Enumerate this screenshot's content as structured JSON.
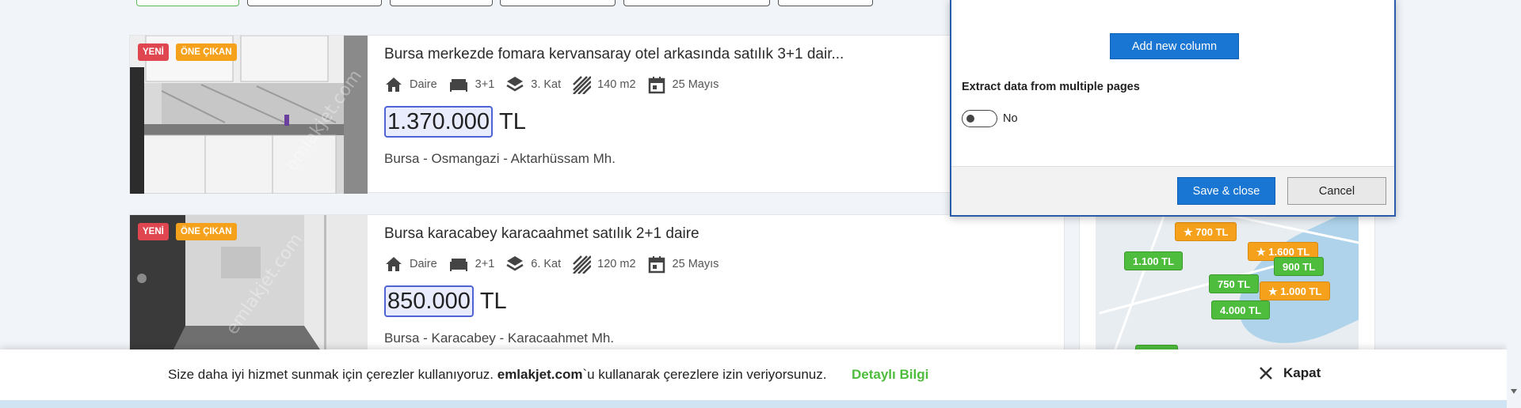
{
  "listings": [
    {
      "badges": [
        "YENİ",
        "ÖNE ÇIKAN"
      ],
      "title": "Bursa merkezde fomara kervansaray otel arkasında satılık 3+1 dair...",
      "type": "Daire",
      "rooms": "3+1",
      "floor": "3. Kat",
      "area": "140 m2",
      "date": "25 Mayıs",
      "price": "1.370.000",
      "currency": "TL",
      "location": "Bursa - Osmangazi - Aktarhüssam Mh.",
      "watermark": "emlakjet.com"
    },
    {
      "badges": [
        "YENİ",
        "ÖNE ÇIKAN"
      ],
      "title": "Bursa karacabey karacaahmet satılık 2+1 daire",
      "type": "Daire",
      "rooms": "2+1",
      "floor": "6. Kat",
      "area": "120 m2",
      "date": "25 Mayıs",
      "price": "850.000",
      "currency": "TL",
      "location": "Bursa - Karacabey - Karacaahmet Mh.",
      "watermark": "emlakjet.com"
    }
  ],
  "map": {
    "pins": [
      {
        "label": "700 TL",
        "color": "orange",
        "star": true
      },
      {
        "label": "1.600 TL",
        "color": "orange",
        "star": true
      },
      {
        "label": "1.100 TL",
        "color": "green",
        "star": false
      },
      {
        "label": "900 TL",
        "color": "green",
        "star": false
      },
      {
        "label": "750 TL",
        "color": "green",
        "star": false
      },
      {
        "label": "1.000 TL",
        "color": "orange",
        "star": true
      },
      {
        "label": "4.000 TL",
        "color": "green",
        "star": false
      }
    ]
  },
  "dialog": {
    "add_column": "Add new column",
    "extract_label": "Extract data from multiple pages",
    "toggle_value": "No",
    "save": "Save & close",
    "cancel": "Cancel"
  },
  "cookie": {
    "text_before": "Size daha iyi hizmet sunmak için çerezler kullanıyoruz. ",
    "brand": "emlakjet.com",
    "text_after": "`u kullanarak çerezlere izin veriyorsunuz.",
    "link": "Detaylı Bilgi",
    "close": "Kapat"
  },
  "colors": {
    "accent_blue": "#1976d2",
    "badge_new": "#e0464f",
    "badge_featured": "#f5a11b",
    "pin_green": "#4ebc3c",
    "link_green": "#4ebc3c"
  }
}
